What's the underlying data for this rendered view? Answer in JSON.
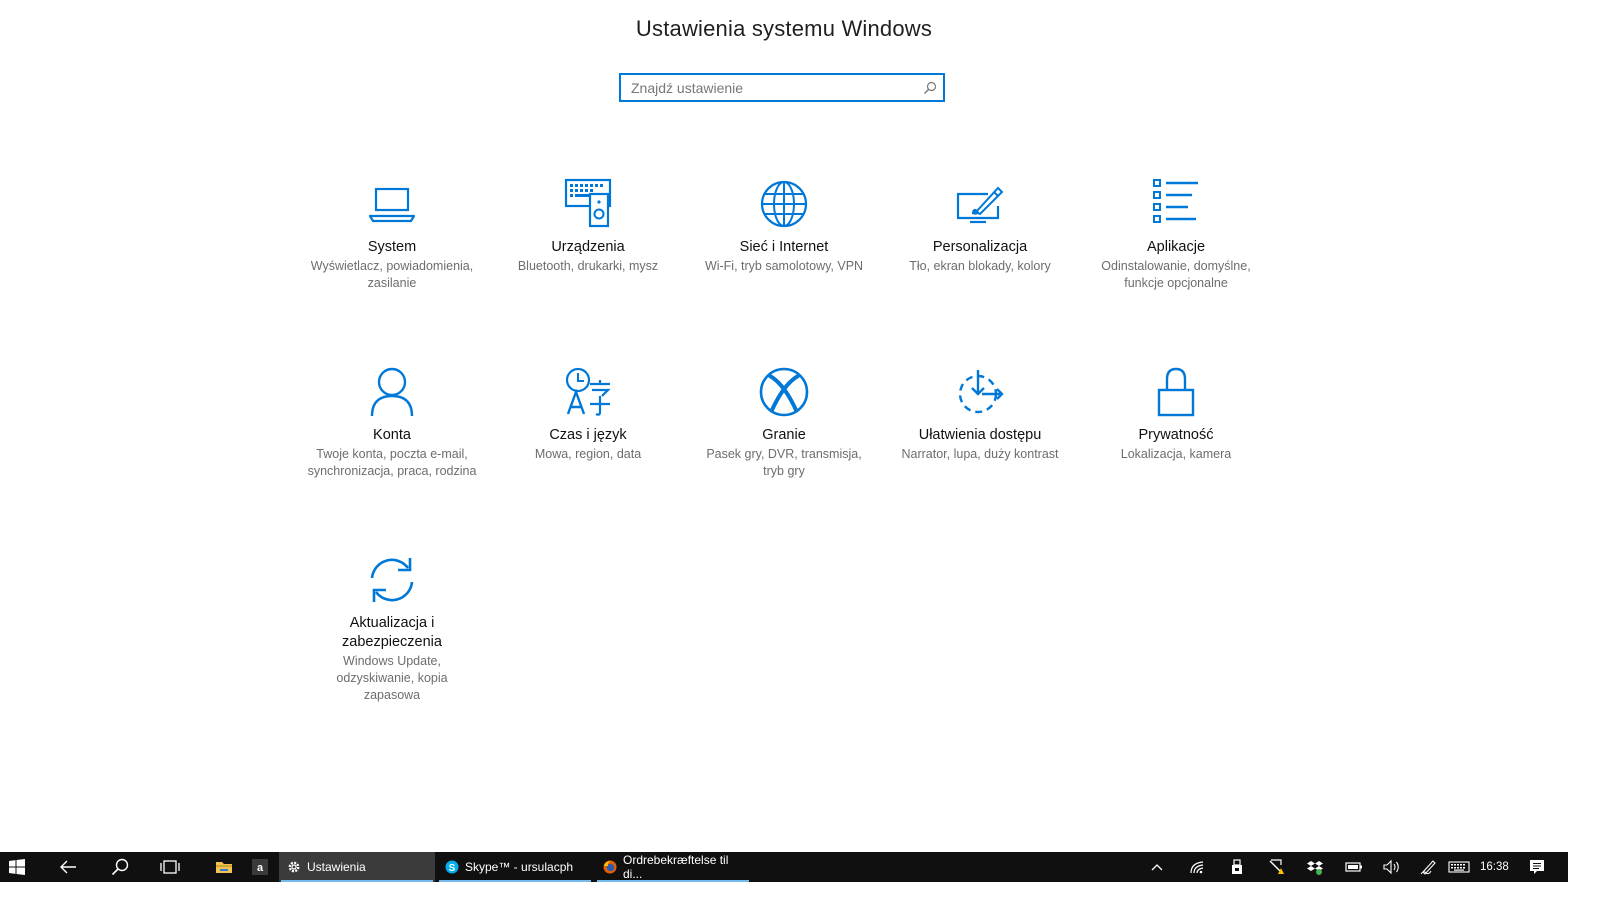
{
  "page": {
    "title": "Ustawienia systemu Windows",
    "search_placeholder": "Znajdź ustawienie"
  },
  "accent_color": "#0078d7",
  "tiles": [
    {
      "icon": "laptop-icon",
      "title": "System",
      "desc": "Wyświetlacz, powiadomienia, zasilanie"
    },
    {
      "icon": "devices-icon",
      "title": "Urządzenia",
      "desc": "Bluetooth, drukarki, mysz"
    },
    {
      "icon": "globe-icon",
      "title": "Sieć i Internet",
      "desc": "Wi-Fi, tryb samolotowy, VPN"
    },
    {
      "icon": "personalization-icon",
      "title": "Personalizacja",
      "desc": "Tło, ekran blokady, kolory"
    },
    {
      "icon": "apps-list-icon",
      "title": "Aplikacje",
      "desc": "Odinstalowanie, domyślne, funkcje opcjonalne"
    },
    {
      "icon": "person-icon",
      "title": "Konta",
      "desc": "Twoje konta, poczta e-mail, synchronizacja, praca, rodzina"
    },
    {
      "icon": "time-language-icon",
      "title": "Czas i język",
      "desc": "Mowa, region, data"
    },
    {
      "icon": "xbox-icon",
      "title": "Granie",
      "desc": "Pasek gry, DVR, transmisja, tryb gry"
    },
    {
      "icon": "ease-of-access-icon",
      "title": "Ułatwienia dostępu",
      "desc": "Narrator, lupa, duży kontrast"
    },
    {
      "icon": "lock-icon",
      "title": "Prywatność",
      "desc": "Lokalizacja, kamera"
    },
    {
      "icon": "sync-icon",
      "title": "Aktualizacja i zabezpieczenia",
      "desc": "Windows Update, odzyskiwanie, kopia zapasowa"
    }
  ],
  "taskbar": {
    "apps": [
      {
        "label": "Ustawienia",
        "icon": "gear-icon"
      },
      {
        "label": "Skype™ - ursulacph",
        "icon": "skype-icon"
      },
      {
        "label": "Ordrebekræftelse til di...",
        "icon": "firefox-icon"
      }
    ],
    "clock": "16:38"
  }
}
